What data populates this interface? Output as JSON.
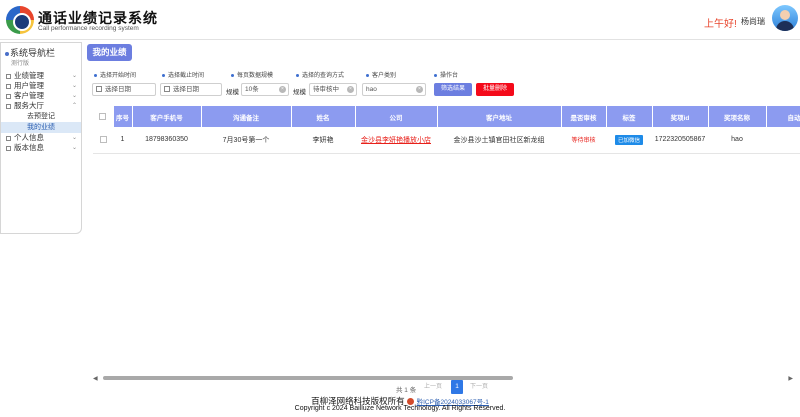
{
  "header": {
    "title": "通话业绩记录系统",
    "subtitle": "Call performance recording system",
    "greeting": "上午好!",
    "user_name": "杨尚瑞"
  },
  "sidebar": {
    "title": "系统导航栏",
    "version": "测行版",
    "items": [
      {
        "label": "业绩管理",
        "expanded": false
      },
      {
        "label": "用户管理",
        "expanded": false
      },
      {
        "label": "客户管理",
        "expanded": false
      },
      {
        "label": "服务大厅",
        "expanded": true,
        "children": [
          {
            "label": "去预登记",
            "active": false
          },
          {
            "label": "我的业绩",
            "active": true
          }
        ]
      },
      {
        "label": "个人信息",
        "expanded": false
      },
      {
        "label": "版本信息",
        "expanded": false
      }
    ]
  },
  "page": {
    "tag": "我的业绩"
  },
  "filters": {
    "labels": {
      "start": "选择开始时间",
      "end": "选择截止时间",
      "page_size": "每页数据规模",
      "query_mode": "选择的查询方式",
      "customer_type": "客户类别",
      "actions": "操作台"
    },
    "start_placeholder": "选择日期",
    "end_placeholder": "选择日期",
    "size_prefix": "规模",
    "size_value": "10条",
    "mode_prefix": "规模",
    "mode_value": "待审核中",
    "keyword_value": "hao",
    "filter_button": "筛选结果",
    "delete_button": "批量删除"
  },
  "table": {
    "columns": [
      "序号",
      "客户手机号",
      "沟通备注",
      "姓名",
      "公司",
      "客户地址",
      "是否审核",
      "标签",
      "奖项id",
      "奖项名称",
      "自动"
    ],
    "rows": [
      {
        "index": "1",
        "phone": "18798360350",
        "remark": "7月30号第一个",
        "name": "李妍艳",
        "company": "金沙县李妍艳播放小店",
        "address": "金沙县沙土镇官田社区新龙组",
        "review": "等待审核",
        "tag": "已加微信",
        "award_id": "1722320505867",
        "award_name": "hao",
        "auto": ""
      }
    ]
  },
  "pagination": {
    "total": "共 1 条",
    "prev": "上一页",
    "current": "1",
    "next": "下一页"
  },
  "footer": {
    "company": "百柳泽网络科技版权所有",
    "icp": "黔ICP备2024033067号-1",
    "copyright": "Copyright c 2024 Bailluze Network Technology. All Rights Reserved."
  },
  "colors": {
    "accent": "#6c7ee0",
    "table_header": "#8c9bf0",
    "danger": "#f40a1a",
    "link": "#2a5db0"
  }
}
